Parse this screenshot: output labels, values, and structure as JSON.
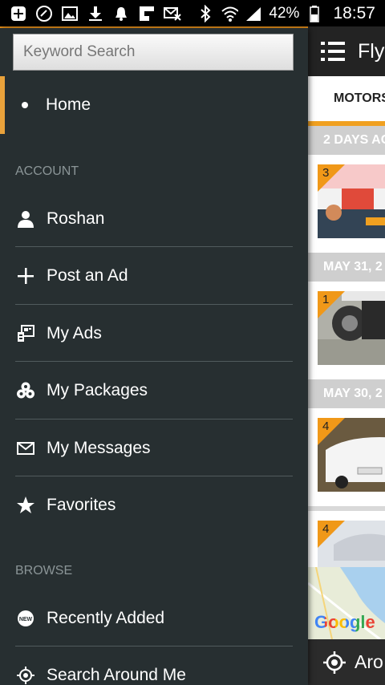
{
  "status_bar": {
    "battery_percent": "42%",
    "time": "18:57"
  },
  "drawer": {
    "search_placeholder": "Keyword Search",
    "home_label": "Home",
    "account_header": "ACCOUNT",
    "account_items": [
      {
        "label": "Roshan",
        "icon": "person-icon"
      },
      {
        "label": "Post an Ad",
        "icon": "plus-icon"
      },
      {
        "label": "My Ads",
        "icon": "my-ads-icon"
      },
      {
        "label": "My Packages",
        "icon": "packages-icon"
      },
      {
        "label": "My Messages",
        "icon": "envelope-icon"
      },
      {
        "label": "Favorites",
        "icon": "star-icon"
      }
    ],
    "browse_header": "BROWSE",
    "browse_items": [
      {
        "label": "Recently Added",
        "icon": "new-badge-icon"
      },
      {
        "label": "Search Around Me",
        "icon": "location-icon"
      }
    ],
    "accent_color": "#e9a23b"
  },
  "main": {
    "app_title": "Fly",
    "tab_label": "MOTORS",
    "dates": [
      "2 DAYS AG",
      "MAY 31, 2",
      "MAY 30, 2"
    ],
    "card_badges": [
      "3",
      "1",
      "4",
      "4"
    ],
    "map_label": "Google",
    "around_label": "Aro"
  }
}
